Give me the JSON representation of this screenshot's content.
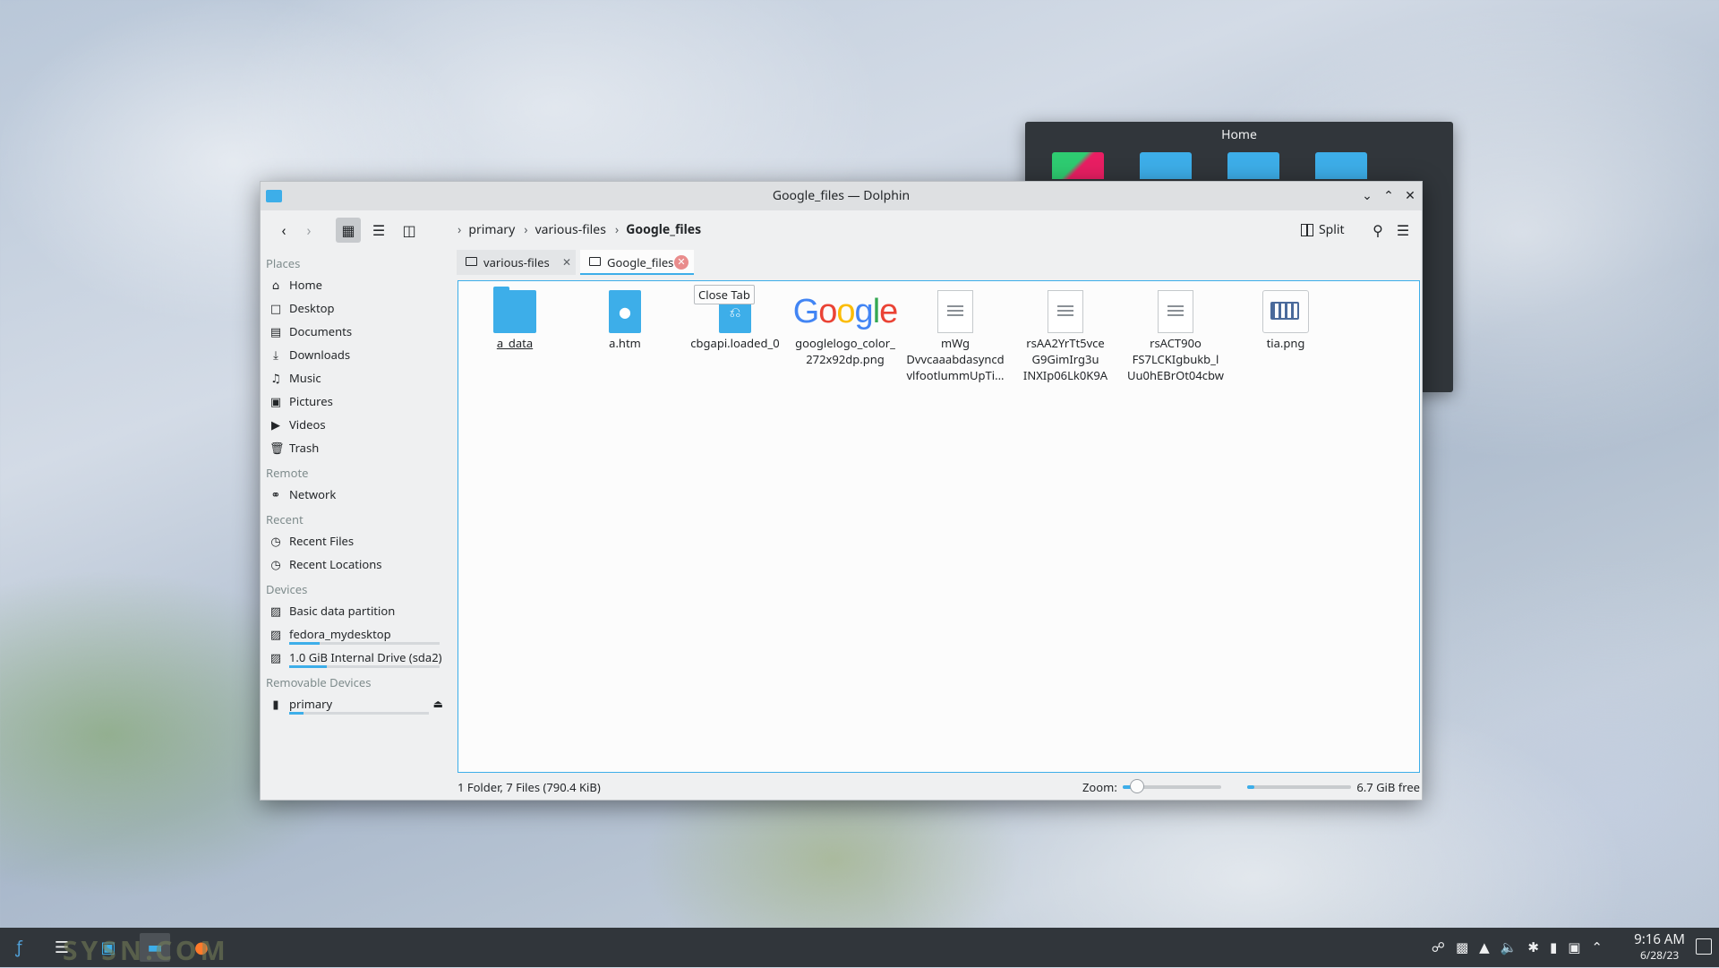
{
  "home_window": {
    "title": "Home"
  },
  "window": {
    "title": "Google_files — Dolphin"
  },
  "toolbar": {
    "breadcrumbs": [
      "primary",
      "various-files",
      "Google_files"
    ],
    "split_label": "Split"
  },
  "places": {
    "sections": [
      {
        "heading": "Places",
        "items": [
          "Home",
          "Desktop",
          "Documents",
          "Downloads",
          "Music",
          "Pictures",
          "Videos",
          "Trash"
        ]
      },
      {
        "heading": "Remote",
        "items": [
          "Network"
        ]
      },
      {
        "heading": "Recent",
        "items": [
          "Recent Files",
          "Recent Locations"
        ]
      },
      {
        "heading": "Devices",
        "items": [
          "Basic data partition",
          "fedora_mydesktop",
          "1.0 GiB Internal Drive (sda2)"
        ]
      },
      {
        "heading": "Removable Devices",
        "items": [
          "primary"
        ]
      }
    ]
  },
  "tabs": [
    {
      "label": "various-files"
    },
    {
      "label": "Google_files"
    }
  ],
  "tooltip": "Close Tab",
  "files": [
    {
      "name_lines": [
        "a_data"
      ],
      "icon": "folder-icon"
    },
    {
      "name_lines": [
        "a.htm"
      ],
      "icon": "html-file-icon"
    },
    {
      "name_lines": [
        "cbgapi.loaded_0"
      ],
      "icon": "js-file-icon"
    },
    {
      "name_lines": [
        "googlelogo_color_",
        "272x92dp.png"
      ],
      "icon": "google-logo-thumbnail"
    },
    {
      "name_lines": [
        "mWg",
        "Dvvcaaabdasyncd",
        "vlfootlummUpTi..."
      ],
      "icon": "text-file-icon"
    },
    {
      "name_lines": [
        "rsAA2YrTt5vce",
        "G9GimIrg3u",
        "INXIp06Lk0K9A"
      ],
      "icon": "text-file-icon"
    },
    {
      "name_lines": [
        "rsACT90o",
        "FS7LCKIgbukb_l",
        "Uu0hEBrOt04cbw"
      ],
      "icon": "text-file-icon"
    },
    {
      "name_lines": [
        "tia.png"
      ],
      "icon": "keyboard-image-icon"
    }
  ],
  "status": {
    "summary": "1 Folder, 7 Files (790.4 KiB)",
    "zoom_label": "Zoom:",
    "free_space": "6.7 GiB free",
    "zoom_level": 0.15,
    "used_fraction": 0.07
  },
  "clock": {
    "time": "9:16 AM",
    "date": "6/28/23"
  },
  "watermark": "SYSN.COM",
  "colors": {
    "accent": "#3daee9",
    "taskbar": "#31363b"
  }
}
